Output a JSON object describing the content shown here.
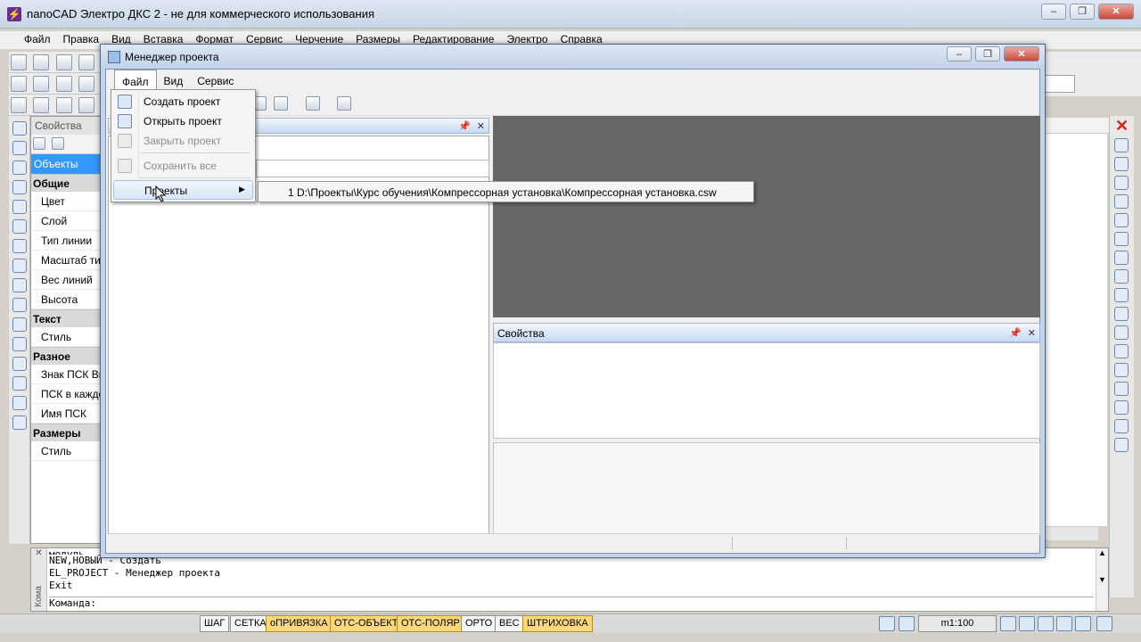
{
  "app": {
    "title": "nanoCAD Электро ДКС 2 - не для коммерческого использования",
    "menu": [
      "Файл",
      "Правка",
      "Вид",
      "Вставка",
      "Формат",
      "Сервис",
      "Черчение",
      "Размеры",
      "Редактирование",
      "Электро",
      "Справка"
    ]
  },
  "properties_panel": {
    "title": "Свойства",
    "selected": "Объекты",
    "sections": [
      {
        "name": "Общие",
        "rows": [
          "Цвет",
          "Слой",
          "Тип линии",
          "Масштаб тип",
          "Вес линий",
          "Высота"
        ]
      },
      {
        "name": "Текст",
        "rows": [
          "Стиль"
        ]
      },
      {
        "name": "Разное",
        "rows": [
          "Знак ПСК Вк",
          "ПСК в каждо",
          "Имя ПСК"
        ]
      },
      {
        "name": "Размеры",
        "rows": [
          "Стиль"
        ]
      }
    ]
  },
  "command_line": {
    "side_label": "Кома",
    "lines": [
      "модуль",
      "NEW,НОВЫЙ - Создать",
      "EL_PROJECT - Менеджер проекта",
      "Exit"
    ],
    "prompt": "Команда:"
  },
  "status_bar": {
    "buttons": [
      {
        "label": "ШАГ",
        "on": false
      },
      {
        "label": "СЕТКА",
        "on": false
      },
      {
        "label": "оПРИВЯЗКА",
        "on": true
      },
      {
        "label": "ОТС-ОБЪЕКТ",
        "on": true
      },
      {
        "label": "ОТС-ПОЛЯР",
        "on": true
      },
      {
        "label": "ОРТО",
        "on": false
      },
      {
        "label": "ВЕС",
        "on": false
      },
      {
        "label": "ШТРИХОВКА",
        "on": true
      }
    ],
    "scale": "m1:100"
  },
  "project_manager": {
    "title": "Менеджер проекта",
    "menu": [
      "Файл",
      "Вид",
      "Сервис"
    ],
    "properties_title": "Свойства",
    "file_menu": {
      "items": [
        {
          "label": "Создать проект",
          "enabled": true,
          "icon": "new-project-icon"
        },
        {
          "label": "Открыть проект",
          "enabled": true,
          "icon": "open-folder-icon"
        },
        {
          "label": "Закрыть проект",
          "enabled": false,
          "icon": "close-project-icon"
        },
        {
          "label": "Сохранить все",
          "enabled": false,
          "icon": "save-all-icon"
        },
        {
          "label": "Проекты",
          "enabled": true,
          "submenu": true
        }
      ]
    },
    "recent_projects": [
      "1 D:\\Проекты\\Курс обучения\\Компрессорная установка\\Компрессорная установка.csw"
    ]
  },
  "colors": {
    "selection": "#3399ff",
    "status_on": "#f9d77c",
    "dark_pane": "#676767",
    "close_red": "#c8493a"
  }
}
